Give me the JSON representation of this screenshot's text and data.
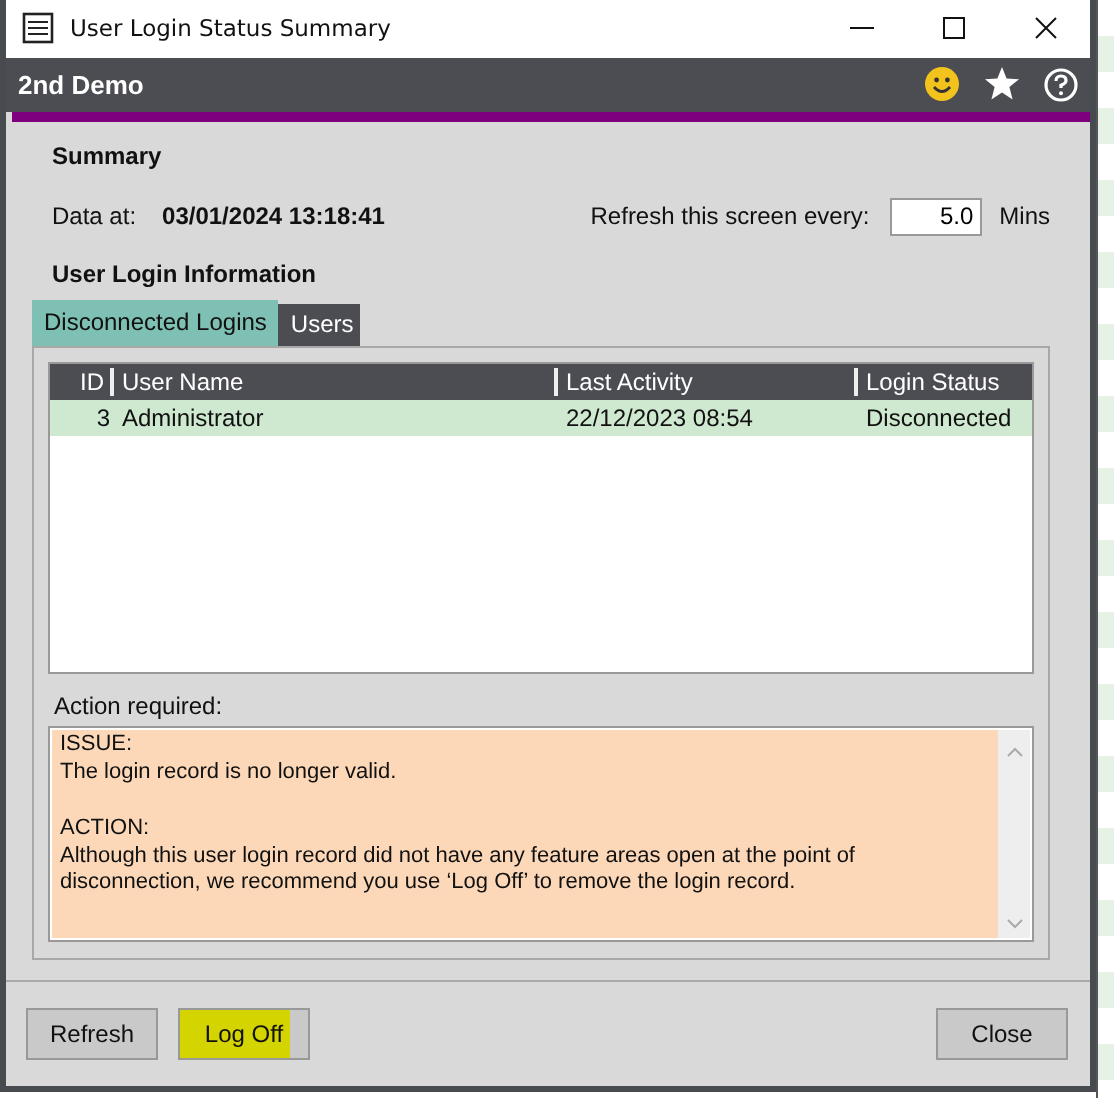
{
  "window": {
    "title": "User Login Status Summary"
  },
  "header": {
    "title": "2nd Demo"
  },
  "summary": {
    "heading": "Summary",
    "data_at_label": "Data at:",
    "data_at_value": "03/01/2024 13:18:41",
    "refresh_label": "Refresh this screen every:",
    "refresh_value": "5.0",
    "refresh_unit": "Mins"
  },
  "section_heading": "User Login Information",
  "tabs": [
    {
      "label": "Disconnected Logins",
      "selected": true
    },
    {
      "label": "Users",
      "selected": false
    }
  ],
  "table": {
    "columns": [
      "ID",
      "User Name",
      "Last Activity",
      "Login Status"
    ],
    "rows": [
      {
        "cells": [
          "3",
          "Administrator",
          "22/12/2023 08:54",
          "Disconnected"
        ],
        "selected": true
      }
    ]
  },
  "action": {
    "label": "Action required:",
    "paragraphs": [
      [
        "ISSUE:",
        "The login record is no longer valid."
      ],
      [
        "ACTION:",
        "Although this user login record did not have any feature areas open at the point of disconnection, we recommend you use ‘Log Off’ to remove the login record."
      ]
    ]
  },
  "buttons": [
    {
      "label": "Refresh",
      "highlighted": false
    },
    {
      "label": "Log Off",
      "highlighted": true
    },
    {
      "label": "Close",
      "highlighted": false
    }
  ]
}
